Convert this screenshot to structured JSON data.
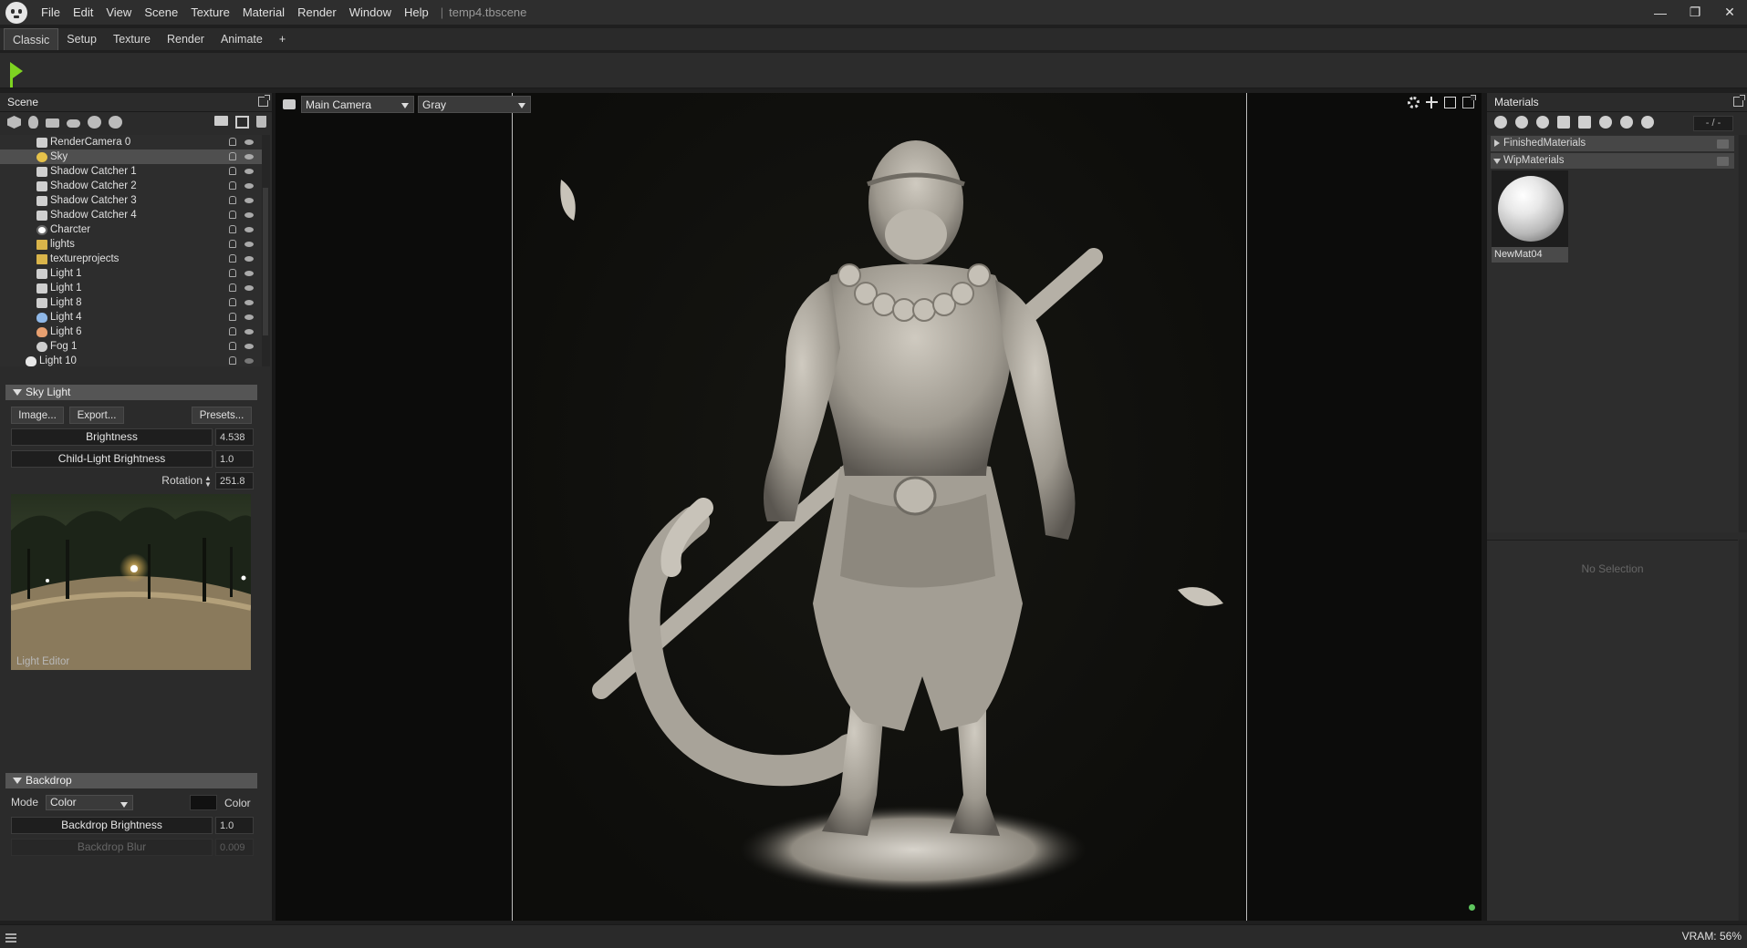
{
  "menubar": {
    "items": [
      "File",
      "Edit",
      "View",
      "Scene",
      "Texture",
      "Material",
      "Render",
      "Window",
      "Help"
    ],
    "separator": "|",
    "doc_title": "temp4.tbscene",
    "window_controls": [
      "minimize-icon",
      "restore-icon",
      "close-icon"
    ]
  },
  "workspace_tabs": [
    "Classic",
    "Setup",
    "Texture",
    "Render",
    "Animate",
    "+"
  ],
  "active_tab": "Classic",
  "scene_panel": {
    "title": "Scene",
    "tree": [
      {
        "label": "RenderCamera 0",
        "icon": "camera-icon",
        "selected": false
      },
      {
        "label": "Sky",
        "icon": "sky-icon",
        "selected": true
      },
      {
        "label": "Shadow Catcher 1",
        "icon": "shadow-catcher-icon",
        "selected": false
      },
      {
        "label": "Shadow Catcher 2",
        "icon": "shadow-catcher-icon",
        "selected": false
      },
      {
        "label": "Shadow Catcher 3",
        "icon": "shadow-catcher-icon",
        "selected": false
      },
      {
        "label": "Shadow Catcher 4",
        "icon": "shadow-catcher-icon",
        "selected": false
      },
      {
        "label": "Charcter",
        "icon": "mesh-icon",
        "selected": false
      },
      {
        "label": "lights",
        "icon": "folder-icon",
        "selected": false
      },
      {
        "label": "textureprojects",
        "icon": "folder-icon",
        "selected": false
      },
      {
        "label": "Light 1",
        "icon": "light-icon",
        "selected": false
      },
      {
        "label": "Light 1",
        "icon": "light-icon",
        "selected": false
      },
      {
        "label": "Light 8",
        "icon": "light-icon",
        "selected": false
      },
      {
        "label": "Light 4",
        "icon": "point-light-icon",
        "selected": false
      },
      {
        "label": "Light 6",
        "icon": "point-light-icon",
        "selected": false
      },
      {
        "label": "Fog 1",
        "icon": "fog-icon",
        "selected": false
      },
      {
        "label": "Light 10",
        "icon": "point-light-icon",
        "selected": false
      }
    ]
  },
  "sky_light": {
    "title": "Sky Light",
    "image_button": "Image...",
    "export_button": "Export...",
    "presets_button": "Presets...",
    "brightness_label": "Brightness",
    "brightness_value": "4.538",
    "child_light_label": "Child-Light Brightness",
    "child_light_value": "1.0",
    "rotation_label": "Rotation",
    "rotation_value": "251.8",
    "preview_label": "Light Editor"
  },
  "backdrop": {
    "title": "Backdrop",
    "mode_label": "Mode",
    "mode_value": "Color",
    "color_label": "Color",
    "color_swatch": "#111111",
    "brightness_label": "Backdrop Brightness",
    "brightness_value": "1.0",
    "blur_label": "Backdrop Blur",
    "blur_value": "0.009"
  },
  "viewport": {
    "camera": "Main Camera",
    "shading": "Gray"
  },
  "materials_panel": {
    "title": "Materials",
    "counter": "- / -",
    "groups": [
      {
        "label": "FinishedMaterials",
        "expanded": false
      },
      {
        "label": "WipMaterials",
        "expanded": true
      }
    ],
    "material_name": "NewMat04",
    "no_selection": "No Selection"
  },
  "status": {
    "vram": "VRAM: 56%"
  },
  "colors": {
    "accent_green": "#7ed321",
    "status_dot": "#5ec65e",
    "selection": "#4f4f4f"
  }
}
